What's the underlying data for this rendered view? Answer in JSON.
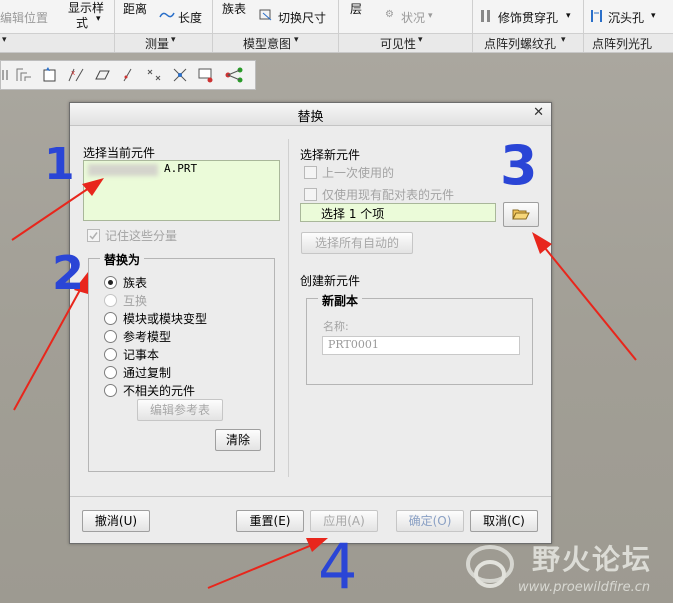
{
  "ribbon": {
    "row1": {
      "edit_position": "编辑位置",
      "display_style_l1": "显示样",
      "display_style_l2": "式",
      "distance": "距离",
      "length": "长度",
      "family_table": "族表",
      "toggle_dimensions": "切换尺寸",
      "layer": "层",
      "status": "状况",
      "cosmetic_thread_hole": "修饰贯穿孔",
      "countersunk_hole": "沉头孔"
    },
    "groups": [
      "测量",
      "模型意图",
      "可见性",
      "点阵列螺纹孔",
      "点阵列光孔"
    ]
  },
  "dialog": {
    "title": "替换",
    "select_current_label": "选择当前元件",
    "current_item": "A.PRT",
    "remember_label": "记住这些分量",
    "replace_with_header": "替换为",
    "options": [
      "族表",
      "互换",
      "模块或模块变型",
      "参考模型",
      "记事本",
      "通过复制",
      "不相关的元件"
    ],
    "selected_option": "族表",
    "edit_ref_table": "编辑参考表",
    "clear": "清除",
    "select_new_label": "选择新元件",
    "last_used": "上一次使用的",
    "only_existing_pairs": "仅使用现有配对表的元件",
    "select_field_value": "选择 1 个项",
    "select_all_auto": "选择所有自动的",
    "create_new_label": "创建新元件",
    "new_copy_header": "新副本",
    "name_label": "名称:",
    "name_value": "PRT0001",
    "buttons": {
      "cancel": "撤消(U)",
      "reset": "重置(E)",
      "apply": "应用(A)",
      "ok": "确定(O)",
      "close": "取消(C)"
    }
  },
  "annotations": [
    "1",
    "2",
    "3",
    "4"
  ],
  "watermark": {
    "name": "野火论坛",
    "url": "www.proewildfire.cn"
  },
  "colors": {
    "highlight_field": "#ebfbd9",
    "annotation_blue": "#2a45d6",
    "arrow_red": "#e8261c"
  }
}
